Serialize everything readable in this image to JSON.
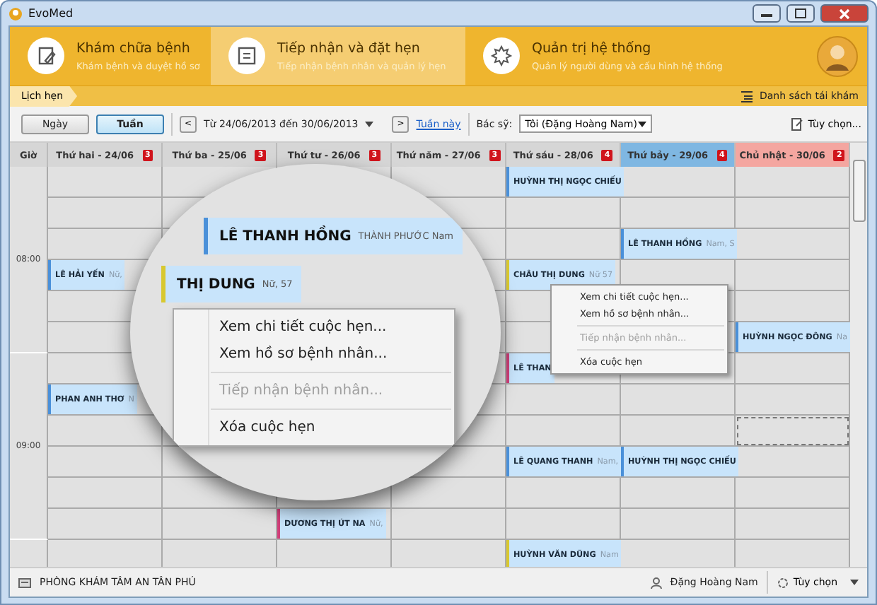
{
  "window": {
    "title": "EvoMed"
  },
  "modules": [
    {
      "title": "Khám chữa bệnh",
      "subtitle": "Khám bệnh và duyệt hồ sơ",
      "selected": false
    },
    {
      "title": "Tiếp nhận và đặt hẹn",
      "subtitle": "Tiếp nhận bệnh nhân và quản lý hẹn",
      "selected": true
    },
    {
      "title": "Quản trị hệ thống",
      "subtitle": "Quản lý người dùng và cấu hình hệ thống",
      "selected": false
    }
  ],
  "breadcrumb": {
    "tab": "Lịch hẹn",
    "link": "Danh sách tái khám"
  },
  "toolbar": {
    "views": [
      {
        "label": "Ngày",
        "selected": false
      },
      {
        "label": "Tuần",
        "selected": true
      }
    ],
    "prev": "<",
    "date_range": "Từ 24/06/2013 đến 30/06/2013",
    "next": ">",
    "this_week": "Tuần này",
    "doctor_label": "Bác sỹ:",
    "doctor": "Tôi (Đặng Hoàng Nam)",
    "options": "Tùy chọn..."
  },
  "calendar": {
    "time_header": "Giờ",
    "days": [
      {
        "label": "Thứ hai - 24/06",
        "count": "3",
        "kind": "weekday"
      },
      {
        "label": "Thứ ba - 25/06",
        "count": "3",
        "kind": "weekday"
      },
      {
        "label": "Thứ tư - 26/06",
        "count": "3",
        "kind": "weekday"
      },
      {
        "label": "Thứ năm - 27/06",
        "count": "3",
        "kind": "weekday"
      },
      {
        "label": "Thứ sáu - 28/06",
        "count": "4",
        "kind": "weekday"
      },
      {
        "label": "Thứ bảy - 29/06",
        "count": "4",
        "kind": "saturday"
      },
      {
        "label": "Chủ nhật - 30/06",
        "count": "2",
        "kind": "sunday"
      }
    ],
    "hours": [
      "08:00",
      "09:00"
    ],
    "appointments": [
      {
        "name": "LÊ HẢI YẾN",
        "info": "Nữ,",
        "color": "#4a90d9"
      },
      {
        "name": "PHAN ANH THƠ",
        "info": "N",
        "color": "#4a90d9"
      },
      {
        "name": "DƯƠNG THỊ ÚT NA",
        "info": "Nữ,",
        "color": "#d0407a"
      },
      {
        "name": "HUỲNH THỊ NGỌC CHIẾU",
        "color": "#4a90d9"
      },
      {
        "name": "CHÂU THỊ DUNG",
        "info": "Nữ 57",
        "color": "#d8c830"
      },
      {
        "name": "LÊ THAN",
        "color": "#d0407a"
      },
      {
        "name": "LÊ QUANG THANH",
        "info": "Nam,",
        "color": "#4a90d9"
      },
      {
        "name": "HUỲNH VĂN DŨNG",
        "info": "Nam",
        "color": "#d8c830"
      },
      {
        "name": "LÊ THANH HỒNG",
        "info": "Nam, S",
        "color": "#4a90d9"
      },
      {
        "name": "HUỲNH THỊ NGỌC CHIẾU",
        "color": "#4a90d9"
      },
      {
        "name": "HUỲNH NGỌC ĐÔNG",
        "info": "Na",
        "color": "#4a90d9"
      }
    ]
  },
  "context_menu": [
    {
      "label": "Xem chi tiết cuộc hẹn...",
      "disabled": false
    },
    {
      "label": "Xem hồ sơ bệnh nhân...",
      "disabled": false
    },
    {
      "label": "Tiếp nhận bệnh nhân...",
      "disabled": true
    },
    {
      "label": "Xóa cuộc hẹn",
      "disabled": false
    }
  ],
  "magnifier": {
    "cards": [
      {
        "name": "LÊ THANH HỒNG",
        "info": "THÀNH PHƯỚC Nam",
        "color": "#4a90d9"
      },
      {
        "name": "THỊ DUNG",
        "info": "Nữ, 57",
        "color": "#d8c830"
      }
    ],
    "menu": [
      {
        "label": "Xem chi tiết cuộc hẹn...",
        "disabled": false
      },
      {
        "label": "Xem hồ sơ bệnh nhân...",
        "disabled": false
      },
      {
        "label": "Tiếp nhận bệnh nhân...",
        "disabled": true
      },
      {
        "label": "Xóa cuộc hẹn",
        "disabled": false
      }
    ]
  },
  "status_bar": {
    "clinic": "PHÒNG KHÁM TÂM AN TÂN PHÚ",
    "user": "Đặng Hoàng Nam",
    "options": "Tùy chọn"
  }
}
